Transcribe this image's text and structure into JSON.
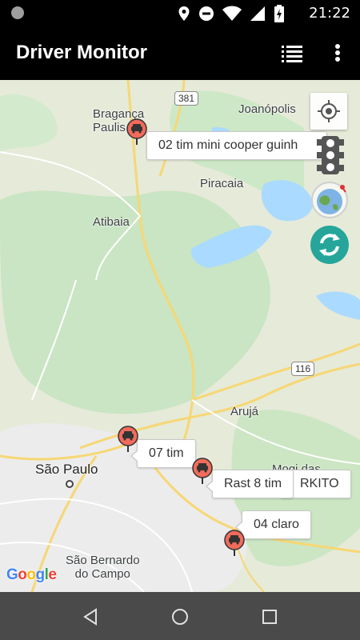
{
  "status_bar": {
    "time": "21:22",
    "icons": [
      "location-icon",
      "do-not-disturb-icon",
      "wifi-icon",
      "signal-icon",
      "battery-charging-icon"
    ]
  },
  "app_bar": {
    "title": "Driver Monitor",
    "actions": [
      "list-icon",
      "more-vert-icon"
    ]
  },
  "map": {
    "places": {
      "braganca": "Bragança\nPaulista",
      "braganca_1": "Bragança",
      "braganca_2": "Paulis",
      "joanopolis": "Joanópolis",
      "piracaia": "Piracaia",
      "atibaia": "Atibaia",
      "aruja": "Arujá",
      "sao_paulo": "São Paulo",
      "mogi": "Mogi das",
      "sbc_1": "São Bernardo",
      "sbc_2": "do Campo"
    },
    "road_shields": {
      "r381": "381",
      "r116": "116"
    },
    "vehicles": [
      {
        "label": "02 tim  mini cooper guinh",
        "color": "#f26b5b"
      },
      {
        "label": "07 tim",
        "color": "#f26b5b"
      },
      {
        "label": "Rast 8 tim",
        "color": "#f26b5b"
      },
      {
        "label": "RKITO",
        "color": "#f26b5b"
      },
      {
        "label": "04 claro",
        "color": "#f26b5b"
      }
    ],
    "attribution": "Google"
  },
  "colors": {
    "accent": "#26a69a",
    "land": "#e6ead9",
    "water": "#aadaff",
    "park": "#c8e6c9",
    "marker": "#f26b5b"
  }
}
